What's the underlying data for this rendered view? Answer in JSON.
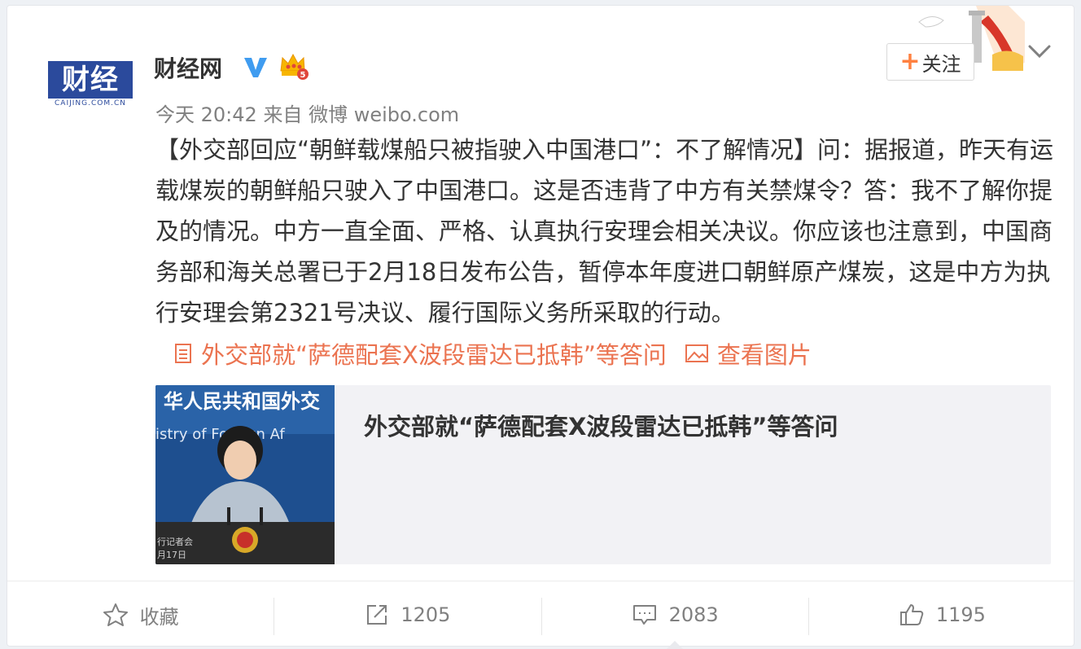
{
  "user": {
    "avatar_text": "财经网",
    "avatar_domain": "CAIJING.COM.CN",
    "name": "财经网",
    "verified_icon": "verified-v-icon",
    "vip_icon": "crown-vip-icon",
    "vip_level": "5"
  },
  "post": {
    "time": "今天 20:42",
    "source_prefix": "来自",
    "source": "微博 weibo.com",
    "text": "【外交部回应“朝鲜载煤船只被指驶入中国港口”：不了解情况】问：据报道，昨天有运载煤炭的朝鲜船只驶入了中国港口。这是否违背了中方有关禁煤令？答：我不了解你提及的情况。中方一直全面、严格、认真执行安理会相关决议。你应该也注意到，中国商务部和海关总署已于2月18日发布公告，暂停本年度进口朝鲜原产煤炭，这是中方为执行安理会第2321号决议、履行国际义务所采取的行动。",
    "article_link": "外交部就“萨德配套X波段雷达已抵韩”等答问",
    "view_images": "查看图片"
  },
  "follow": {
    "plus": "+",
    "label": "关注"
  },
  "article_card": {
    "title": "外交部就“萨德配套X波段雷达已抵韩”等答问",
    "thumb_banner": "华人民共和国外交",
    "thumb_banner_en": "istry of Foreign Af",
    "thumb_caption_1": "行记者会",
    "thumb_caption_2": "月17日"
  },
  "actions": {
    "favorite": "收藏",
    "repost_count": "1205",
    "comment_count": "2083",
    "like_count": "1195"
  },
  "colors": {
    "link": "#eb7350",
    "accent": "#ff8140",
    "verified": "#3f9cf0",
    "text": "#333333",
    "meta": "#808080"
  }
}
